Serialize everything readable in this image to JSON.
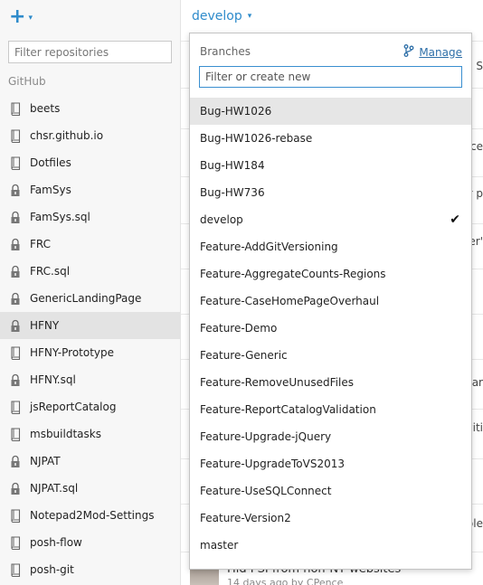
{
  "toolbar": {
    "add_glyph": "+",
    "caret_glyph": "▾"
  },
  "sidebar": {
    "filter_placeholder": "Filter repositories",
    "group_label": "GitHub",
    "repos": [
      {
        "label": "beets",
        "icon": "repo-icon"
      },
      {
        "label": "chsr.github.io",
        "icon": "repo-icon"
      },
      {
        "label": "Dotfiles",
        "icon": "repo-icon"
      },
      {
        "label": "FamSys",
        "icon": "lock-icon"
      },
      {
        "label": "FamSys.sql",
        "icon": "lock-icon"
      },
      {
        "label": "FRC",
        "icon": "lock-icon"
      },
      {
        "label": "FRC.sql",
        "icon": "lock-icon"
      },
      {
        "label": "GenericLandingPage",
        "icon": "lock-icon"
      },
      {
        "label": "HFNY",
        "icon": "lock-icon",
        "selected": true
      },
      {
        "label": "HFNY-Prototype",
        "icon": "repo-icon"
      },
      {
        "label": "HFNY.sql",
        "icon": "lock-icon"
      },
      {
        "label": "jsReportCatalog",
        "icon": "repo-icon"
      },
      {
        "label": "msbuildtasks",
        "icon": "repo-icon"
      },
      {
        "label": "NJPAT",
        "icon": "lock-icon"
      },
      {
        "label": "NJPAT.sql",
        "icon": "lock-icon"
      },
      {
        "label": "Notepad2Mod-Settings",
        "icon": "repo-icon"
      },
      {
        "label": "posh-flow",
        "icon": "repo-icon"
      },
      {
        "label": "posh-git",
        "icon": "repo-icon"
      }
    ]
  },
  "branch_selector": {
    "current": "develop"
  },
  "dropdown": {
    "title": "Branches",
    "manage_label": "Manage",
    "filter_placeholder": "Filter or create new",
    "checkmark": "✔",
    "branches": [
      {
        "name": "Bug-HW1026",
        "highlighted": true
      },
      {
        "name": "Bug-HW1026-rebase"
      },
      {
        "name": "Bug-HW184"
      },
      {
        "name": "Bug-HW736"
      },
      {
        "name": "develop",
        "checked": true
      },
      {
        "name": "Feature-AddGitVersioning"
      },
      {
        "name": "Feature-AggregateCounts-Regions"
      },
      {
        "name": "Feature-CaseHomePageOverhaul"
      },
      {
        "name": "Feature-Demo"
      },
      {
        "name": "Feature-Generic"
      },
      {
        "name": "Feature-RemoveUnusedFiles"
      },
      {
        "name": "Feature-ReportCatalogValidation"
      },
      {
        "name": "Feature-Upgrade-jQuery"
      },
      {
        "name": "Feature-UpgradeToVS2013"
      },
      {
        "name": "Feature-UseSQLConnect"
      },
      {
        "name": "Feature-Version2"
      },
      {
        "name": "master"
      }
    ]
  },
  "background": {
    "fragments": [
      "S",
      "ce",
      "r p",
      "er'",
      "nar",
      "viti",
      "ple"
    ],
    "commit_title": "Hid PSI from non-NY websites",
    "commit_sub": "14 days ago by CPence"
  },
  "colors": {
    "accent": "#2e8bcb",
    "selected_row": "#e3e3e3",
    "highlight_row": "#e6e6e6"
  }
}
